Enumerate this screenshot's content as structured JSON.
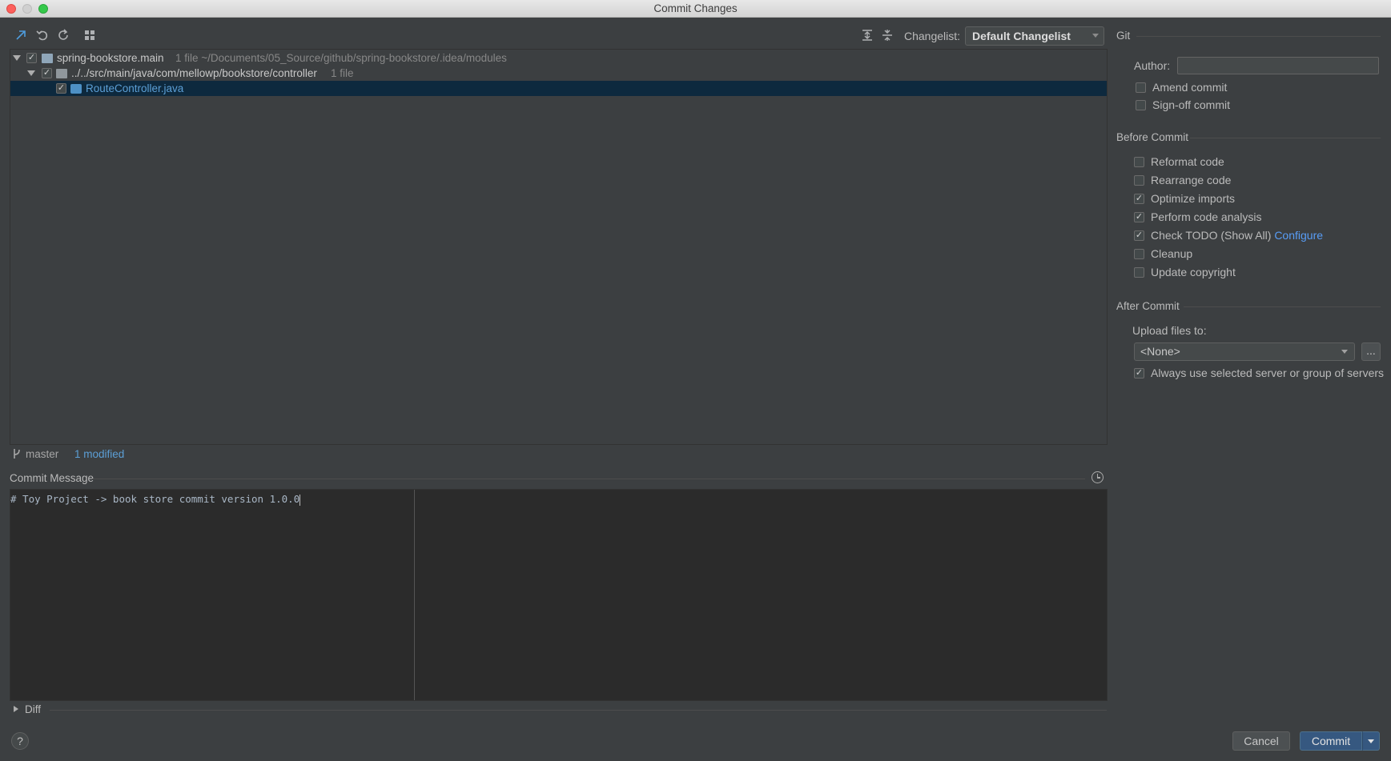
{
  "window": {
    "title": "Commit Changes"
  },
  "toolbar": {
    "icons": [
      "show-diff-icon",
      "rollback-icon",
      "refresh-icon",
      "group-by-icon",
      "expand-all-icon",
      "collapse-all-icon"
    ],
    "changelist_label": "Changelist:",
    "changelist_value": "Default Changelist"
  },
  "tree": {
    "rows": [
      {
        "name": "spring-bookstore.main",
        "meta": "1 file  ~/Documents/05_Source/github/spring-bookstore/.idea/modules",
        "checked": true
      },
      {
        "name": "../../src/main/java/com/mellowp/bookstore/controller",
        "meta": "1 file",
        "checked": true
      },
      {
        "name": "RouteController.java",
        "meta": "",
        "checked": true,
        "selected": true
      }
    ]
  },
  "status": {
    "branch": "master",
    "modified": "1 modified"
  },
  "commit_message": {
    "title": "Commit Message",
    "text": "# Toy Project -> book store commit version 1.0.0"
  },
  "diff": {
    "label": "Diff"
  },
  "git": {
    "title": "Git",
    "author_label": "Author:",
    "author_value": "",
    "amend": {
      "label": "Amend commit",
      "checked": false
    },
    "signoff": {
      "label": "Sign-off commit",
      "checked": false
    }
  },
  "before_commit": {
    "title": "Before Commit",
    "options": [
      {
        "label": "Reformat code",
        "checked": false
      },
      {
        "label": "Rearrange code",
        "checked": false
      },
      {
        "label": "Optimize imports",
        "checked": true
      },
      {
        "label": "Perform code analysis",
        "checked": true
      },
      {
        "label": "Check TODO (Show All)",
        "checked": true,
        "link": "Configure"
      },
      {
        "label": "Cleanup",
        "checked": false
      },
      {
        "label": "Update copyright",
        "checked": false
      }
    ]
  },
  "after_commit": {
    "title": "After Commit",
    "upload_label": "Upload files to:",
    "upload_value": "<None>",
    "more_label": "...",
    "always_use": {
      "label": "Always use selected server or group of servers",
      "checked": true
    }
  },
  "buttons": {
    "help": "?",
    "cancel": "Cancel",
    "commit": "Commit"
  },
  "colors": {
    "accent": "#365880",
    "link": "#589df6",
    "selection": "#0d293e"
  }
}
